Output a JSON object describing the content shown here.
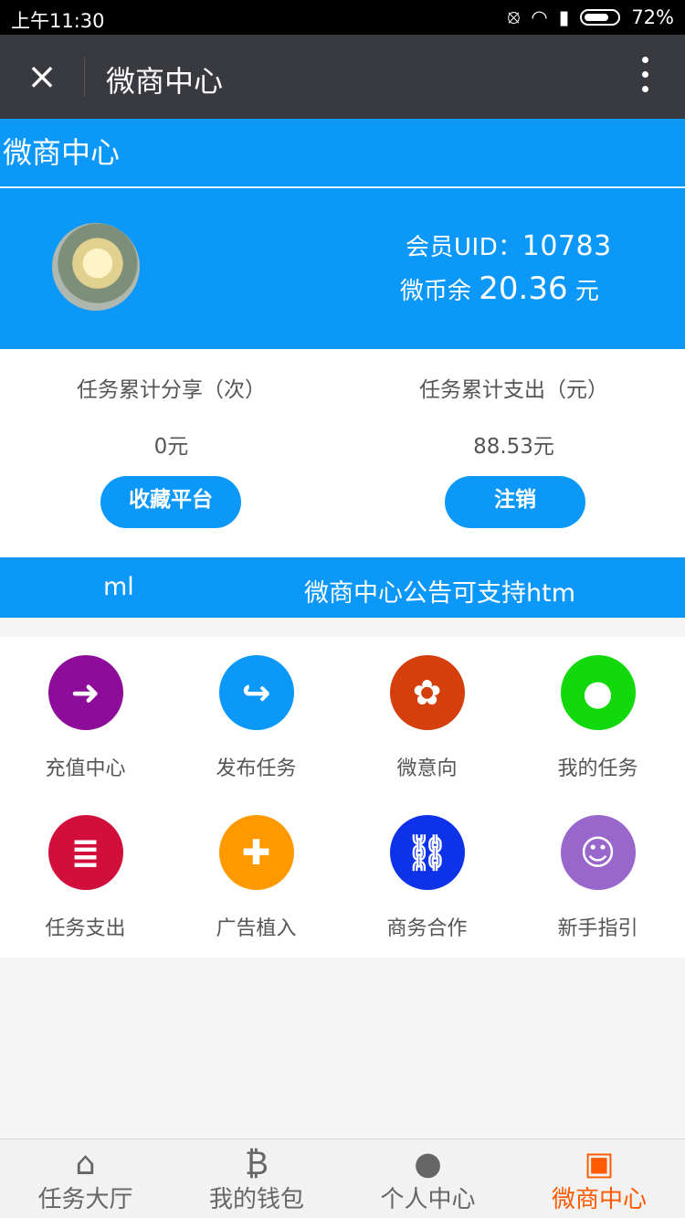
{
  "status": {
    "time": "上午11:30",
    "battery": "72%",
    "icons": [
      "mute-icon",
      "wifi-icon",
      "signal-icon",
      "battery-icon"
    ]
  },
  "toolbar": {
    "close_icon": "×",
    "title": "微商中心",
    "more_icon": "⋮"
  },
  "header": {
    "title": "微商中心"
  },
  "profile": {
    "uid_label": "会员UID：",
    "uid_value": "10783",
    "coin_prefix": "微币余 ",
    "coin_value": "20.36",
    "coin_unit": " 元"
  },
  "stats": {
    "left": {
      "label": "任务累计分享（次）",
      "value": "0元",
      "button": "收藏平台"
    },
    "right": {
      "label": "任务累计支出（元）",
      "value": "88.53元",
      "button": "注销"
    }
  },
  "notice": {
    "part1": "ml",
    "part2": "微商中心公告可支持htm"
  },
  "grid_items": [
    {
      "label": "充值中心",
      "icon": "login-icon",
      "glyph": "➜",
      "color": "#8e0c9a"
    },
    {
      "label": "发布任务",
      "icon": "share-icon",
      "glyph": "↪",
      "color": "#0c98f8"
    },
    {
      "label": "微意向",
      "icon": "plant-icon",
      "glyph": "✿",
      "color": "#d53f0e"
    },
    {
      "label": "我的任务",
      "icon": "location-icon",
      "glyph": "●",
      "color": "#12d90b"
    },
    {
      "label": "任务支出",
      "icon": "outdent-icon",
      "glyph": "≣",
      "color": "#d20f3b"
    },
    {
      "label": "广告植入",
      "icon": "puzzle-icon",
      "glyph": "✚",
      "color": "#ff9900"
    },
    {
      "label": "商务合作",
      "icon": "link-icon",
      "glyph": "⛓",
      "color": "#0d32e8"
    },
    {
      "label": "新手指引",
      "icon": "reddit-icon",
      "glyph": "☺",
      "color": "#9966cc"
    }
  ],
  "nav": [
    {
      "label": "任务大厅",
      "icon": "home-icon",
      "glyph": "⌂"
    },
    {
      "label": "我的钱包",
      "icon": "bitcoin-icon",
      "glyph": "₿"
    },
    {
      "label": "个人中心",
      "icon": "user-icon",
      "glyph": "●"
    },
    {
      "label": "微商中心",
      "icon": "money-icon",
      "glyph": "▣"
    }
  ],
  "colors": {
    "accent": "#0c98f8",
    "active_nav": "#ff5a00",
    "appbar": "#393a3f"
  }
}
